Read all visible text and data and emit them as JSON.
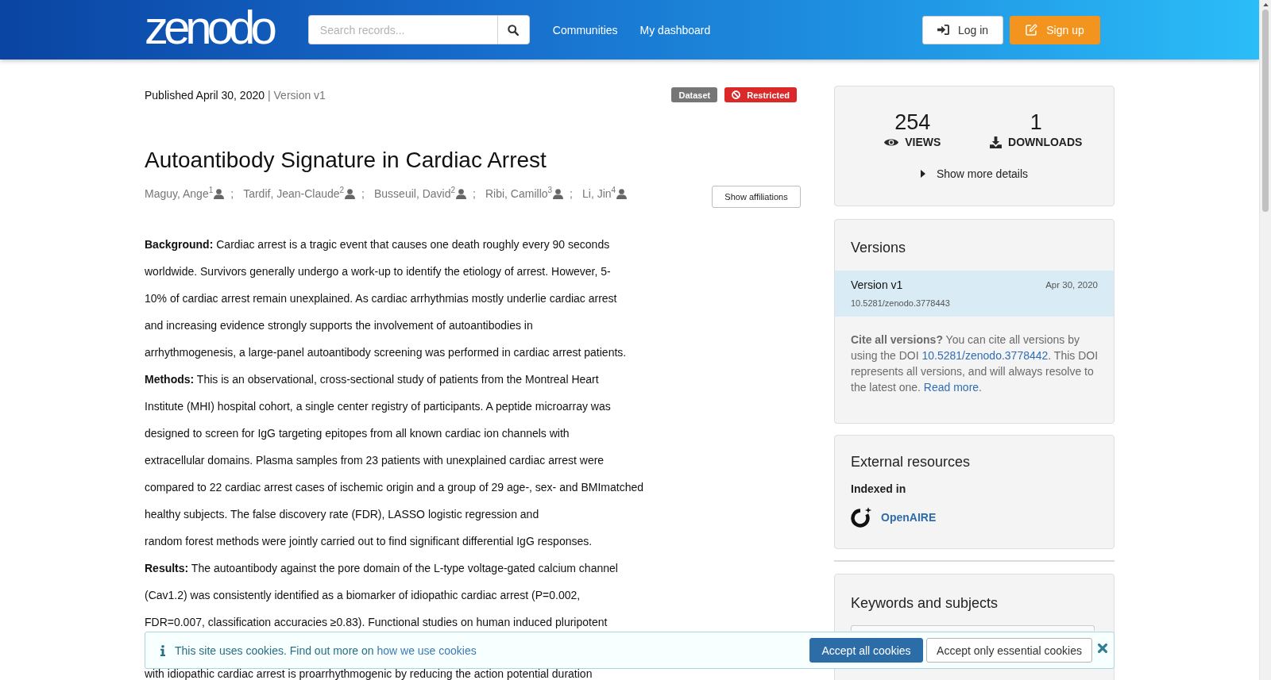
{
  "header": {
    "logo": "zenodo",
    "search": {
      "placeholder": "Search records..."
    },
    "nav": [
      {
        "label": "Communities"
      },
      {
        "label": "My dashboard"
      }
    ],
    "buttons": [
      {
        "kind": "login",
        "label": "Log in"
      },
      {
        "kind": "signup",
        "label": "Sign up"
      }
    ]
  },
  "record": {
    "published": "Published April 30, 2020",
    "version": "| Version v1",
    "badges": [
      {
        "kind": "resource_type",
        "label": "Dataset"
      },
      {
        "kind": "access",
        "label": "Restricted"
      }
    ],
    "title": "Autoantibody Signature in Cardiac Arrest",
    "creators": [
      {
        "name": "Maguy, Ange$^{1}$",
        "separator": ";"
      },
      {
        "name": "Tardif, Jean-Claude$^{2}$",
        "separator": ";"
      },
      {
        "name": "Busseuil, David$^{2}$",
        "separator": ";"
      },
      {
        "name": "Ribi, Camillo$^{3}$",
        "separator": ";"
      },
      {
        "name": "Li, Jin$^{4}$"
      }
    ],
    "affiliations_button": "Show affiliations",
    "abstract": {
      "above_banner": [
        "**Background:** Cardiac arrest is a tragic event that causes one death roughly every 90 seconds",
        "worldwide. Survivors generally undergo a work-up to identify the etiology of arrest. However, 5-",
        "10% of cardiac arrest remain unexplained. As cardiac arrhythmias mostly underlie cardiac arrest",
        "and increasing evidence strongly supports the involvement of autoantibodies in",
        "arrhythmogenesis, a large-panel autoantibody screening was performed in cardiac arrest patients.",
        "**Methods:** This is an observational, cross-sectional study of patients from the Montreal Heart",
        "Institute (MHI) hospital cohort, a single center registry of participants. A peptide microarray was",
        "designed to screen for IgG targeting epitopes from all known cardiac ion channels with",
        "extracellular domains. Plasma samples from 23 patients with unexplained cardiac arrest were",
        "compared to 22 cardiac arrest cases of ischemic origin and a group of 29 age-, sex- and BMImatched",
        "healthy subjects. The false discovery rate (FDR), LASSO logistic regression and",
        "random forest methods were jointly carried out to find significant differential IgG responses.",
        "**Results:** The autoantibody against the pore domain of the L-type voltage-gated calcium channel",
        "(Cav1.2) was consistently identified as a biomarker of idiopathic cardiac arrest (P=0.002,",
        "FDR=0.007, classification accuracies ≥0.83). Functional studies on human induced pluripotent"
      ],
      "below_banner": [
        "with idiopathic cardiac arrest is proarrhythmogenic by reducing the action potential duration"
      ]
    }
  },
  "sidebar": {
    "stats": [
      {
        "kind": "views",
        "value": "254",
        "label": "VIEWS"
      },
      {
        "kind": "downloads",
        "value": "1",
        "label": "DOWNLOADS"
      }
    ],
    "details_toggle": {
      "label": "Show more details",
      "expanded": false
    },
    "versions": {
      "title": "Versions",
      "items": [
        {
          "label": "Version v1",
          "date": "Apr 30, 2020",
          "doi": "10.5281/zenodo.3778443",
          "selected": true
        }
      ],
      "cite_note": [
        {
          "kind": "text",
          "text": "**Cite all versions?** You can cite all versions by using the DOI "
        },
        {
          "kind": "link",
          "text": "10.5281/zenodo.3778442"
        },
        {
          "kind": "text",
          "text": ". This DOI represents all versions, and will always resolve to the latest one. "
        },
        {
          "kind": "link",
          "text": "Read more"
        },
        {
          "kind": "text",
          "text": "."
        }
      ]
    },
    "external_resources": {
      "title": "External resources",
      "subtitle": "Indexed in",
      "links": [
        {
          "label": "OpenAIRE"
        }
      ]
    },
    "keywords": {
      "title": "Keywords and subjects"
    }
  },
  "cookie_banner": {
    "message": "This site uses cookies. Find out more on ",
    "link": "how we use cookies",
    "buttons": [
      {
        "kind": "accept_all",
        "label": "Accept all cookies"
      },
      {
        "kind": "accept_essential",
        "label": "Accept only essential cookies"
      }
    ]
  }
}
